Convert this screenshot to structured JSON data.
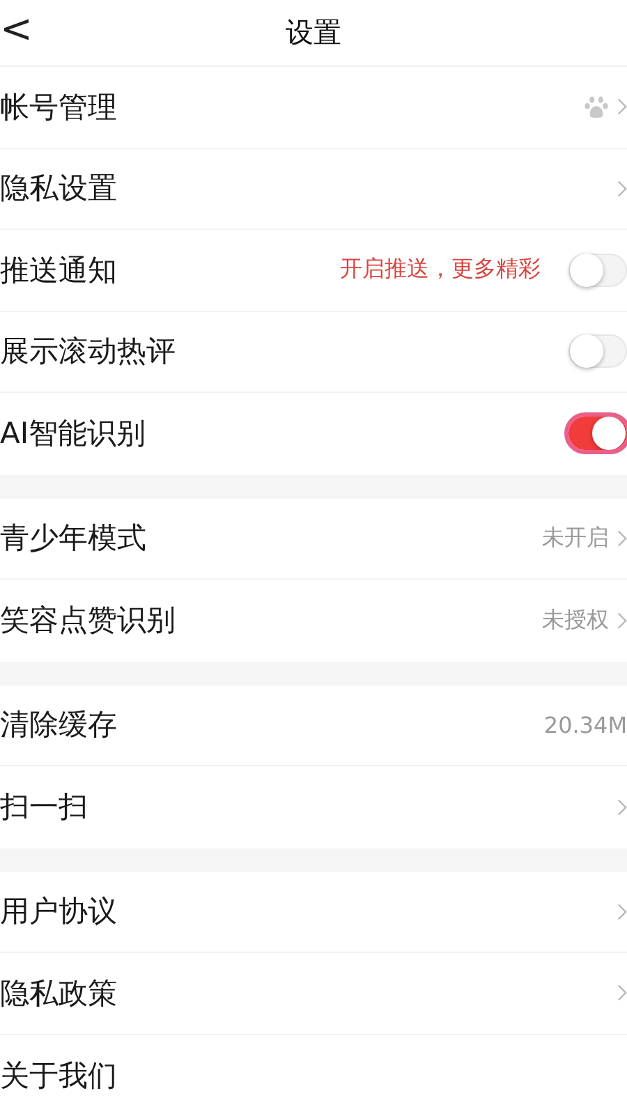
{
  "header": {
    "back": "<",
    "title": "设置"
  },
  "groups": [
    {
      "items": [
        {
          "kind": "account",
          "label": "帐号管理"
        },
        {
          "kind": "link",
          "label": "隐私设置"
        },
        {
          "kind": "toggle",
          "label": "推送通知",
          "hint": "开启推送，更多精彩",
          "on": false,
          "highlighted": false
        },
        {
          "kind": "toggle",
          "label": "展示滚动热评",
          "on": false,
          "highlighted": false
        },
        {
          "kind": "toggle",
          "label": "AI智能识别",
          "on": true,
          "highlighted": true
        }
      ]
    },
    {
      "items": [
        {
          "kind": "link",
          "label": "青少年模式",
          "value": "未开启"
        },
        {
          "kind": "link",
          "label": "笑容点赞识别",
          "value": "未授权"
        }
      ]
    },
    {
      "items": [
        {
          "kind": "value",
          "label": "清除缓存",
          "value": "20.34M"
        },
        {
          "kind": "link",
          "label": "扫一扫"
        }
      ]
    },
    {
      "items": [
        {
          "kind": "link",
          "label": "用户协议"
        },
        {
          "kind": "link",
          "label": "隐私政策"
        },
        {
          "kind": "plain",
          "label": "关于我们"
        }
      ]
    }
  ]
}
